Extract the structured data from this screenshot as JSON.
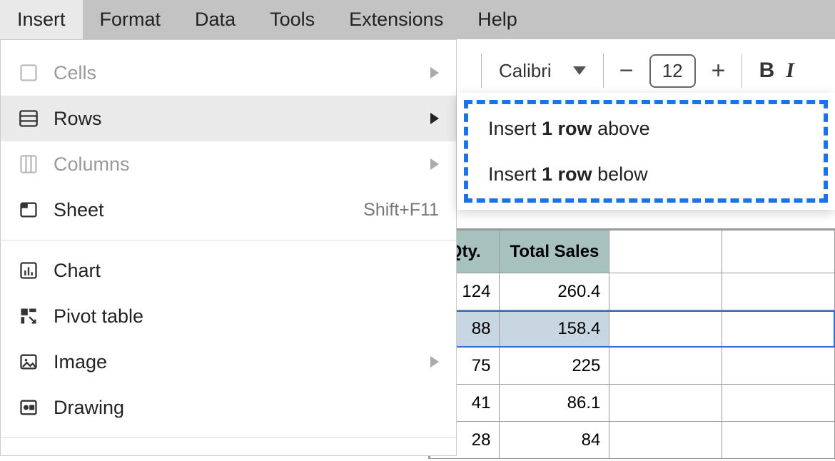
{
  "menubar": {
    "items": [
      "Insert",
      "Format",
      "Data",
      "Tools",
      "Extensions",
      "Help"
    ],
    "active_index": 0
  },
  "toolbar": {
    "font_name": "Calibri",
    "font_size": "12",
    "decrease_label": "−",
    "increase_label": "+",
    "bold_label": "B",
    "italic_label": "I"
  },
  "dropdown": {
    "items": [
      {
        "icon": "cells-icon",
        "label": "Cells",
        "arrow": true,
        "disabled": true
      },
      {
        "icon": "rows-icon",
        "label": "Rows",
        "arrow": true,
        "hover": true
      },
      {
        "icon": "columns-icon",
        "label": "Columns",
        "arrow": true,
        "disabled": true
      },
      {
        "icon": "sheet-icon",
        "label": "Sheet",
        "shortcut": "Shift+F11"
      }
    ],
    "items2": [
      {
        "icon": "chart-icon",
        "label": "Chart"
      },
      {
        "icon": "pivot-icon",
        "label": "Pivot table"
      },
      {
        "icon": "image-icon",
        "label": "Image",
        "arrow": true,
        "arrow_dim": true
      },
      {
        "icon": "drawing-icon",
        "label": "Drawing"
      }
    ]
  },
  "submenu": {
    "above": {
      "prefix": "Insert ",
      "bold": "1 row",
      "suffix": " above"
    },
    "below": {
      "prefix": "Insert ",
      "bold": "1 row",
      "suffix": " below"
    }
  },
  "sheet": {
    "headers": [
      "Qty.",
      "Total Sales"
    ],
    "rows": [
      {
        "qty": "124",
        "total": "260.4"
      },
      {
        "qty": "88",
        "total": "158.4",
        "selected": true
      },
      {
        "qty": "75",
        "total": "225"
      },
      {
        "qty": "41",
        "total": "86.1"
      },
      {
        "qty": "28",
        "total": "84"
      }
    ]
  }
}
